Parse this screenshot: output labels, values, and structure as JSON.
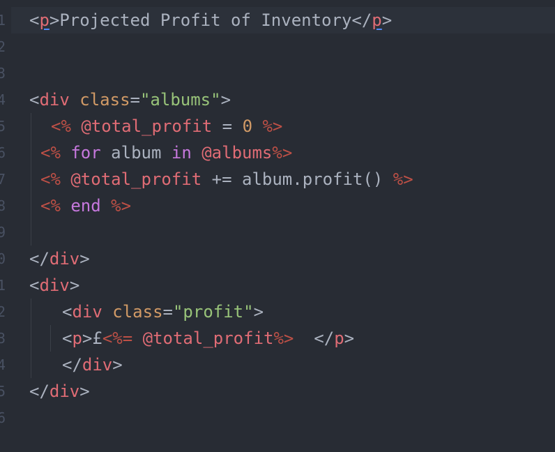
{
  "gutter": {
    "line_numbers": [
      "1",
      "2",
      "3",
      "4",
      "5",
      "6",
      "7",
      "8",
      "9",
      "0",
      "1",
      "2",
      "3",
      "4",
      "5",
      "6"
    ]
  },
  "code": {
    "l1": {
      "lt": "<",
      "tag": "p",
      "gt": ">",
      "text": "Projected Profit of Inventory",
      "close_lt": "</",
      "close_tag": "p",
      "close_gt": ">"
    },
    "l4": {
      "lt": "<",
      "tag": "div",
      "sp": " ",
      "attr": "class",
      "eq": "=",
      "val": "\"albums\"",
      "gt": ">"
    },
    "l5": {
      "open": "<%",
      "sp1": " ",
      "ivar": "@total_profit",
      "op": " = ",
      "num": "0",
      "sp2": " ",
      "close": "%>"
    },
    "l6": {
      "open": "<%",
      "sp1": " ",
      "kw1": "for",
      "t1": " album ",
      "kw2": "in",
      "sp2": " ",
      "ivar": "@albums",
      "close": "%>"
    },
    "l7": {
      "open": "<%",
      "sp1": " ",
      "ivar": "@total_profit",
      "t1": " += album.profit() ",
      "close": "%>"
    },
    "l8": {
      "open": "<%",
      "sp1": " ",
      "kw": "end",
      "sp2": " ",
      "close": "%>"
    },
    "l10": {
      "lt": "</",
      "tag": "div",
      "gt": ">"
    },
    "l11": {
      "lt": "<",
      "tag": "div",
      "gt": ">"
    },
    "l12": {
      "lt": "<",
      "tag": "div",
      "sp": " ",
      "attr": "class",
      "eq": "=",
      "val": "\"profit\"",
      "gt": ">"
    },
    "l13": {
      "lt": "<",
      "tag": "p",
      "gt": ">",
      "pound": "£",
      "open": "<%=",
      "sp1": " ",
      "ivar": "@total_profit",
      "close": "%>",
      "sp2": "  ",
      "close_lt": "</",
      "close_tag": "p",
      "close_gt": ">"
    },
    "l14": {
      "lt": "</",
      "tag": "div",
      "gt": ">"
    },
    "l15": {
      "lt": "</",
      "tag": "div",
      "gt": ">"
    }
  }
}
